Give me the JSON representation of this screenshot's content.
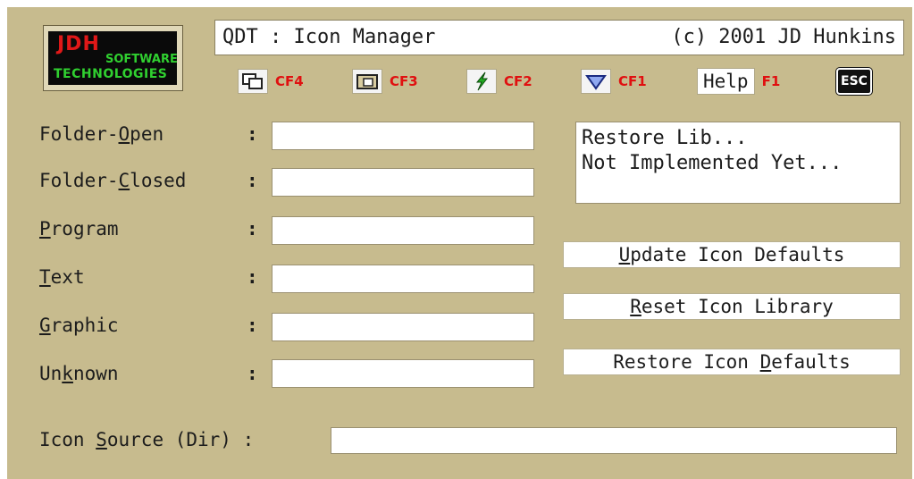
{
  "logo": {
    "line1": "JDH",
    "line2": "SOFTWARE",
    "line3": "TECHNOLOGIES"
  },
  "title": {
    "left": "QDT : Icon Manager",
    "right": "(c) 2001 JD Hunkins"
  },
  "toolbar": {
    "cf4": "CF4",
    "cf3": "CF3",
    "cf2": "CF2",
    "cf1": "CF1",
    "help": "Help",
    "f1": "F1",
    "esc": "ESC"
  },
  "fields": {
    "folder_open": {
      "pre": "Folder-",
      "key": "O",
      "post": "pen",
      "value": ""
    },
    "folder_closed": {
      "pre": "Folder-",
      "key": "C",
      "post": "losed",
      "value": ""
    },
    "program": {
      "pre": "",
      "key": "P",
      "post": "rogram",
      "value": ""
    },
    "text": {
      "pre": "",
      "key": "T",
      "post": "ext",
      "value": ""
    },
    "graphic": {
      "pre": "",
      "key": "G",
      "post": "raphic",
      "value": ""
    },
    "unknown": {
      "pre": "Un",
      "key": "k",
      "post": "nown",
      "value": ""
    },
    "colon": ":"
  },
  "messages": {
    "line1": "Restore Lib...",
    "line2": "Not Implemented Yet..."
  },
  "buttons": {
    "update": {
      "pre": "",
      "key": "U",
      "post": "pdate Icon Defaults"
    },
    "reset": {
      "pre": "",
      "key": "R",
      "post": "eset Icon Library"
    },
    "restore": {
      "pre": "Restore Icon ",
      "key": "D",
      "post": "efaults"
    }
  },
  "source": {
    "pre": "Icon ",
    "key": "S",
    "post": "ource (Dir) :",
    "value": ""
  }
}
